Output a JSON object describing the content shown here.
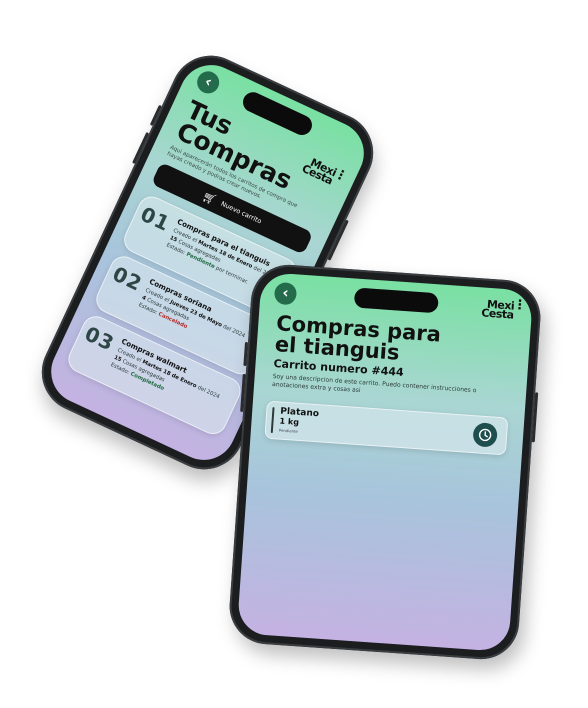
{
  "app": {
    "logo_line1": "Mexi",
    "logo_line2": "Cesta",
    "back_label": "‹",
    "menu_label": "⋮"
  },
  "purchases_screen": {
    "title_line1": "Tus",
    "title_line2": "Compras",
    "subtitle": "Aqui aparecerán todos los carritos de compra que hayas creado y podras crear nuevos.",
    "new_cart_label": "Nuevo carrito",
    "purchases": [
      {
        "number": "01",
        "name": "Compras para el tianguis",
        "created_prefix": "Creado el",
        "created_date": "Martes 18 de Enero",
        "created_suffix": "del 2024",
        "items_count": "15",
        "items_label": "Cosas agregadas",
        "status_prefix": "Estado:",
        "status": "Pendiente",
        "status_suffix": "por terminar."
      },
      {
        "number": "02",
        "name": "Compras soriana",
        "created_prefix": "Creado el",
        "created_date": "Jueves 23 de Mayo",
        "created_suffix": "del 2024",
        "items_count": "4",
        "items_label": "Cosas agregadas",
        "status_prefix": "Estado:",
        "status": "Cancelado",
        "status_suffix": ""
      },
      {
        "number": "03",
        "name": "Compras walmart",
        "created_prefix": "Creado el",
        "created_date": "Martes 18 de Enero",
        "created_suffix": "del 2024",
        "items_count": "15",
        "items_label": "Cosas agregadas",
        "status_prefix": "Estado:",
        "status": "Completado",
        "status_suffix": ""
      }
    ]
  },
  "cart_screen": {
    "title_line1": "Compras para",
    "title_line2": "el tianguis",
    "cart_name": "Carrito numero #444",
    "description": "Soy una descripcion de este carrito. Puedo contener instrucciones o anotaciones extra y cosas asi",
    "items": [
      {
        "name": "Platano",
        "quantity": "1 kg",
        "status": "Pendiente"
      }
    ]
  },
  "colors": {
    "gradient_top": "#79e0a2",
    "gradient_bottom": "#c4b2e2",
    "accent_dark": "#236b4a",
    "status_pending": "#1e6a3e",
    "status_cancelled": "#b32b2b"
  }
}
